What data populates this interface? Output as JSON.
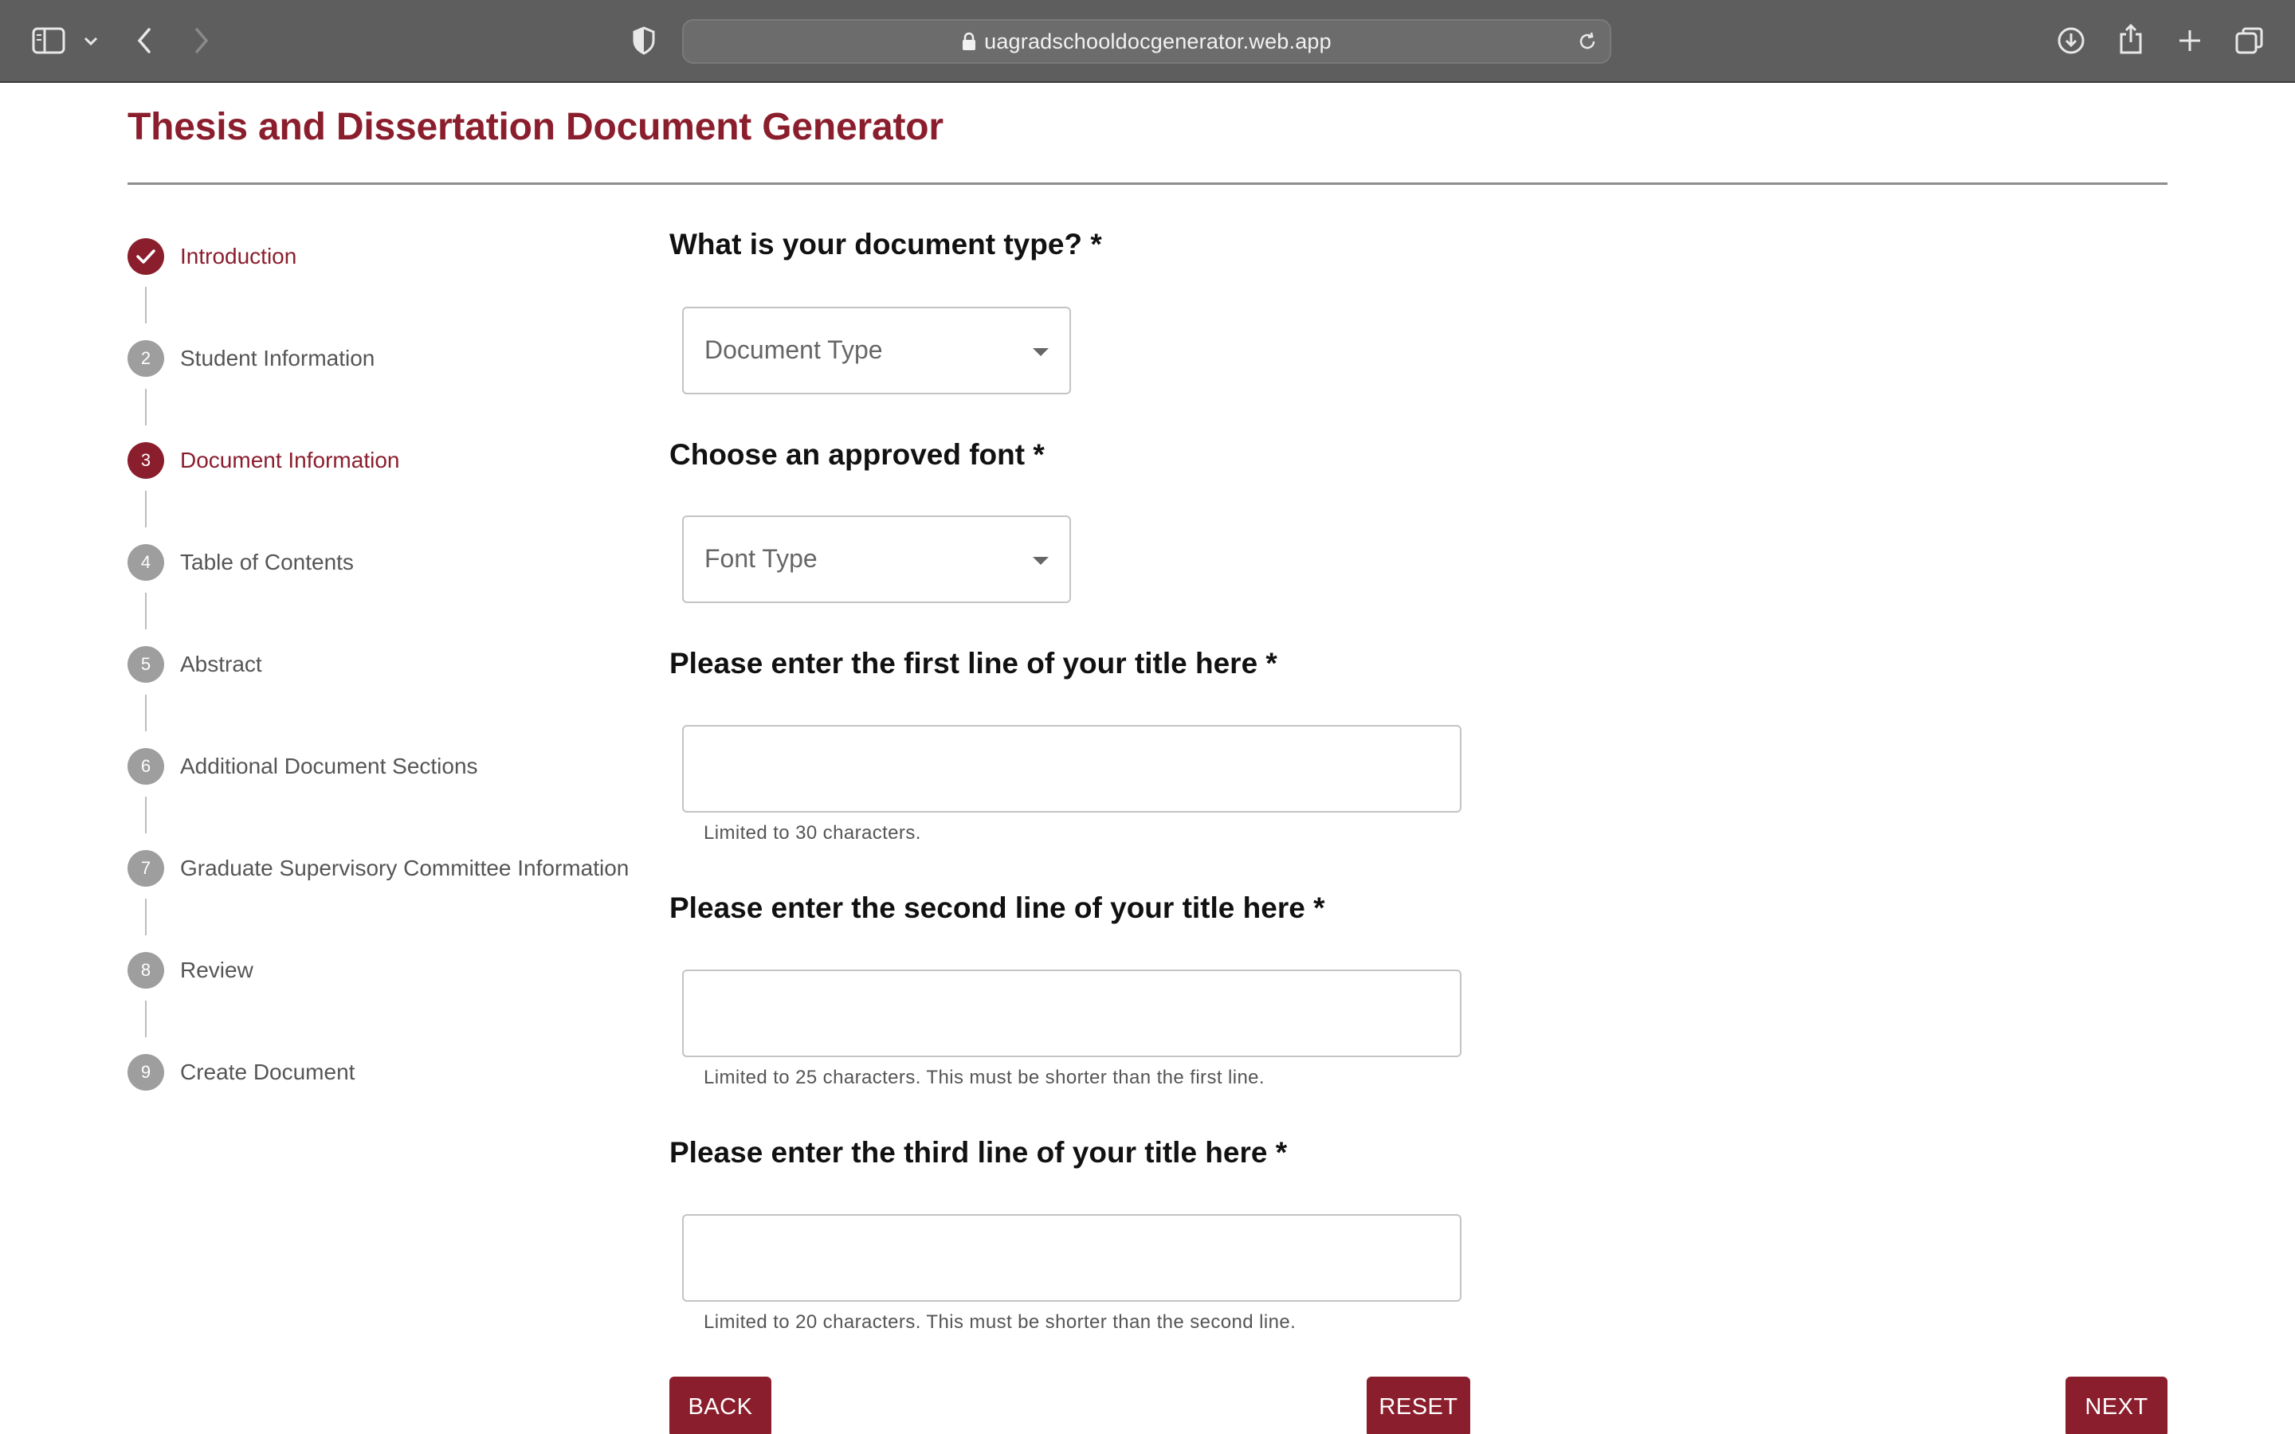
{
  "browser": {
    "url": "uagradschooldocgenerator.web.app",
    "icons": [
      "sidebar-icon",
      "chevron-down-icon",
      "back-arrow-icon",
      "forward-arrow-icon",
      "shield-icon",
      "lock-icon",
      "reload-icon",
      "download-icon",
      "share-icon",
      "plus-icon",
      "tabs-icon"
    ]
  },
  "page": {
    "title": "Thesis and Dissertation Document Generator"
  },
  "stepper": {
    "steps": [
      {
        "number": "",
        "label": "Introduction",
        "state": "completed"
      },
      {
        "number": "2",
        "label": "Student Information",
        "state": "inactive"
      },
      {
        "number": "3",
        "label": "Document Information",
        "state": "active"
      },
      {
        "number": "4",
        "label": "Table of Contents",
        "state": "inactive"
      },
      {
        "number": "5",
        "label": "Abstract",
        "state": "inactive"
      },
      {
        "number": "6",
        "label": "Additional Document Sections",
        "state": "inactive"
      },
      {
        "number": "7",
        "label": "Graduate Supervisory Committee Information",
        "state": "inactive"
      },
      {
        "number": "8",
        "label": "Review",
        "state": "inactive"
      },
      {
        "number": "9",
        "label": "Create Document",
        "state": "inactive"
      }
    ]
  },
  "form": {
    "doc_type": {
      "label": "What is your document type? *",
      "placeholder": "Document Type"
    },
    "font": {
      "label": "Choose an approved font *",
      "placeholder": "Font Type"
    },
    "title_line1": {
      "label": "Please enter the first line of your title here *",
      "value": "",
      "hint": "Limited to 30 characters."
    },
    "title_line2": {
      "label": "Please enter the second line of your title here *",
      "value": "",
      "hint": "Limited to 25 characters. This must be shorter than the first line."
    },
    "title_line3": {
      "label": "Please enter the third line of your title here *",
      "value": "",
      "hint": "Limited to 20 characters. This must be shorter than the second line."
    }
  },
  "buttons": {
    "back": "BACK",
    "reset": "RESET",
    "next": "NEXT"
  },
  "colors": {
    "accent": "#8b1e2d",
    "inactive_step": "#9e9e9e",
    "toolbar": "#5e5e5e"
  }
}
